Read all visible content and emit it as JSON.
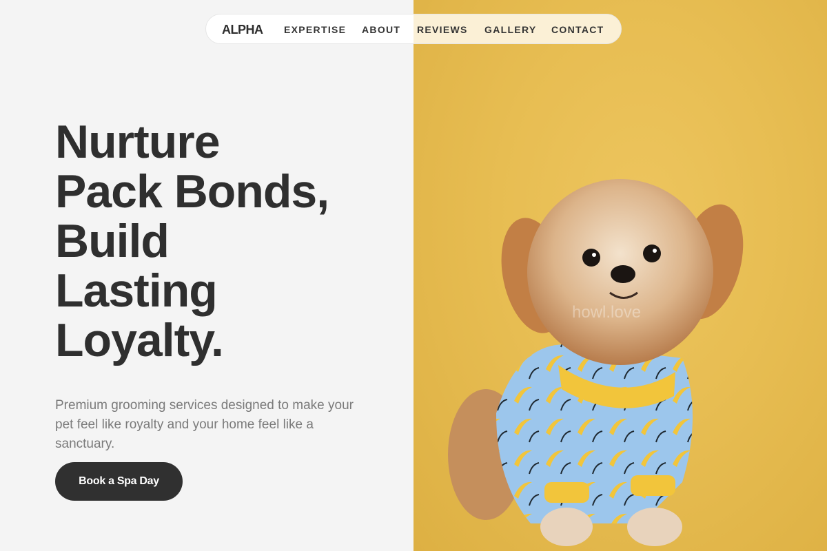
{
  "nav": {
    "brand": "ALPHA",
    "items": [
      "EXPERTISE",
      "ABOUT",
      "REVIEWS",
      "GALLERY",
      "CONTACT"
    ]
  },
  "hero": {
    "title_lines": [
      "Nurture",
      "Pack Bonds,",
      "Build",
      "Lasting",
      "Loyalty."
    ],
    "subtitle": "Premium grooming services designed to make your pet feel like royalty and your home feel like a sanctuary.",
    "cta": "Book a Spa Day"
  },
  "image": {
    "watermark": "howl.love",
    "background_color": "#e7bd52",
    "pajama_color": "#9cc6ec",
    "banana_color": "#f2c53b"
  }
}
